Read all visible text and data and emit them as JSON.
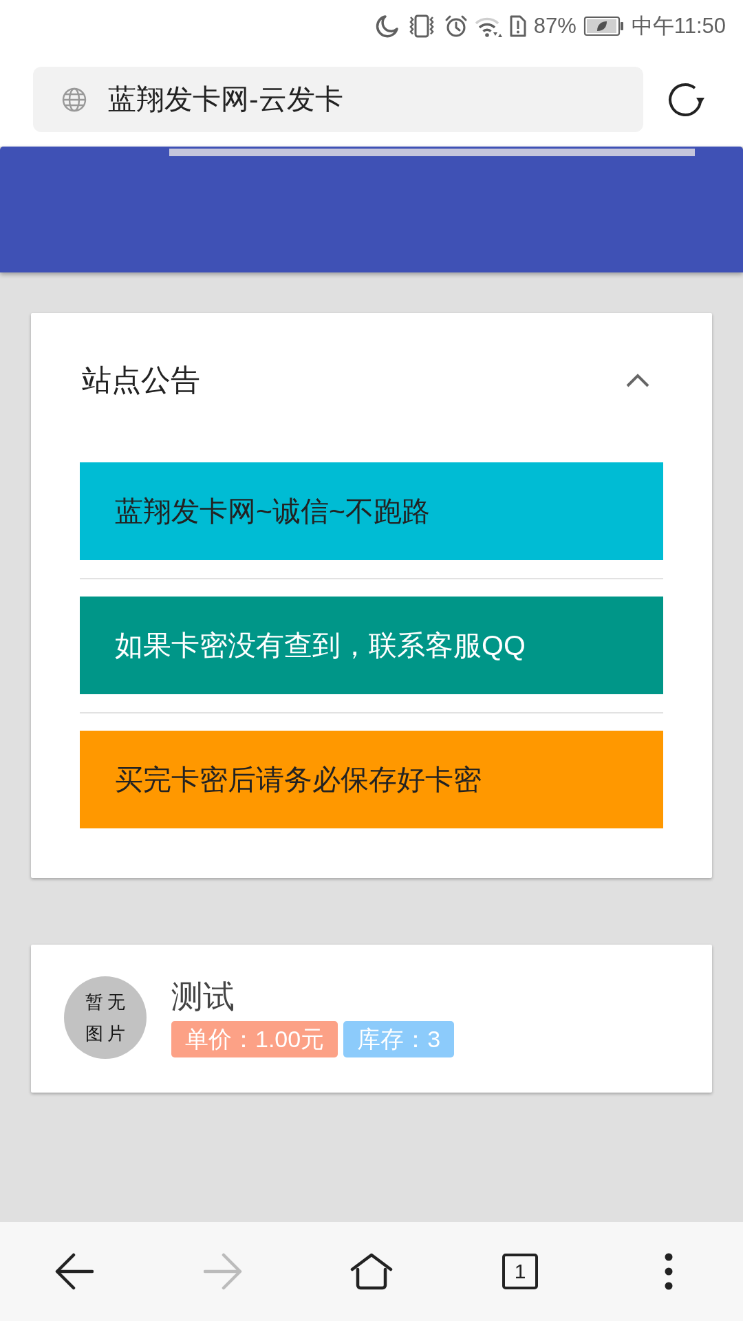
{
  "status_bar": {
    "battery": "87%",
    "time": "中午11:50"
  },
  "address_bar": {
    "title": "蓝翔发卡网-云发卡"
  },
  "notice_panel": {
    "title": "站点公告",
    "expanded": true,
    "alerts": [
      {
        "text": "蓝翔发卡网~诚信~不跑路",
        "color": "#00bcd4"
      },
      {
        "text": "如果卡密没有查到，联系客服QQ",
        "color": "#009688"
      },
      {
        "text": "买完卡密后请务必保存好卡密",
        "color": "#ff9800"
      }
    ]
  },
  "products": [
    {
      "image_text": "暂无图片",
      "name": "测试",
      "price": "单价：1.00元",
      "stock": "库存：3"
    }
  ],
  "bottom_nav": [
    {
      "kind": "back",
      "disabled": false
    },
    {
      "kind": "forward",
      "disabled": true
    },
    {
      "kind": "home",
      "disabled": false
    },
    {
      "kind": "tabs",
      "label": "1",
      "disabled": false
    },
    {
      "kind": "menu",
      "disabled": false
    }
  ]
}
